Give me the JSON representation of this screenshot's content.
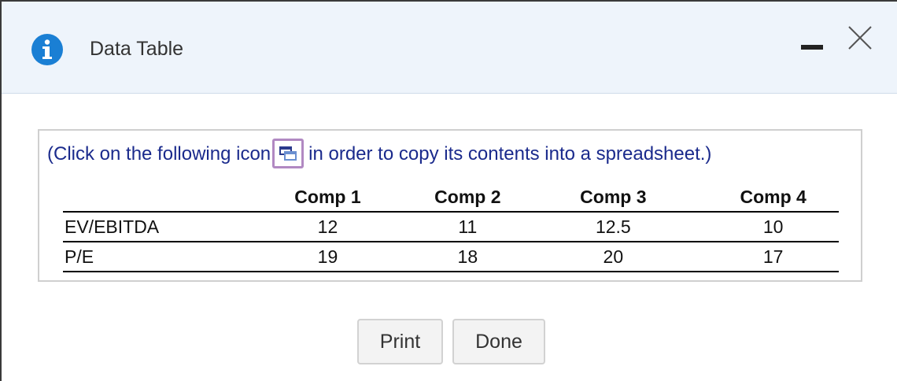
{
  "dialog": {
    "title": "Data Table",
    "icon": "info-icon",
    "controls": {
      "minimize": "minimize-icon",
      "close": "close-icon"
    }
  },
  "instruction": {
    "before": "(Click on the following icon",
    "icon": "copy-to-spreadsheet-icon",
    "after": "in order to copy its contents into a spreadsheet.)"
  },
  "table": {
    "headers": [
      "",
      "Comp 1",
      "Comp 2",
      "Comp 3",
      "Comp 4"
    ],
    "rows": [
      {
        "label": "EV/EBITDA",
        "values": [
          "12",
          "11",
          "12.5",
          "10"
        ]
      },
      {
        "label": "P/E",
        "values": [
          "19",
          "18",
          "20",
          "17"
        ]
      }
    ]
  },
  "buttons": {
    "print": "Print",
    "done": "Done"
  },
  "colors": {
    "instruction_text": "#1a2a8c",
    "info_icon": "#1a7fd4",
    "copy_icon_border": "#b189c2",
    "titlebar": "#eef4fb"
  }
}
